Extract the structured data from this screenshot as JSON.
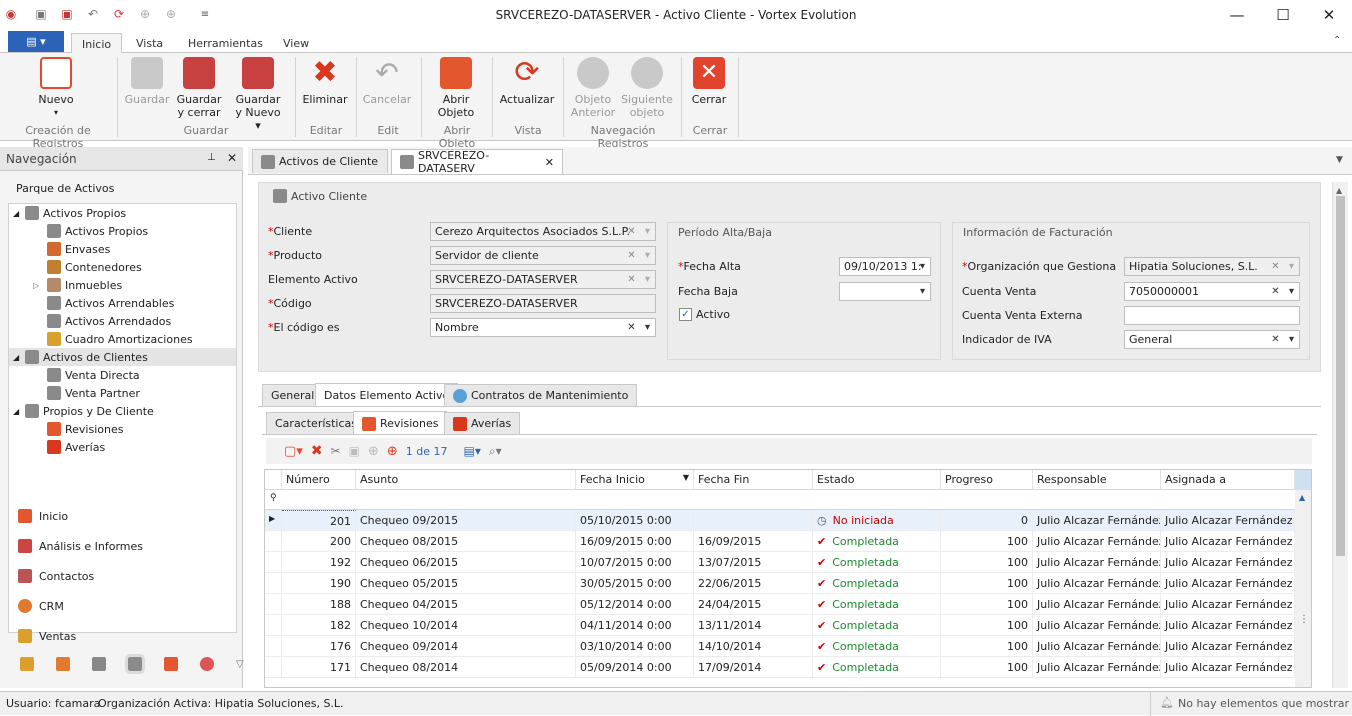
{
  "window": {
    "title": "SRVCEREZO-DATASERVER - Activo Cliente - Vortex Evolution"
  },
  "ribbon_tabs": [
    "Inicio",
    "Vista",
    "Herramientas",
    "View"
  ],
  "ribbon": {
    "buttons": {
      "nuevo": "Nuevo",
      "guardar": "Guardar",
      "guardar_cerrar_1": "Guardar",
      "guardar_cerrar_2": "y cerrar",
      "guardar_nuevo_1": "Guardar",
      "guardar_nuevo_2": "y Nuevo",
      "eliminar": "Eliminar",
      "cancelar": "Cancelar",
      "abrir_1": "Abrir",
      "abrir_2": "Objeto",
      "actualizar": "Actualizar",
      "obj_ant_1": "Objeto",
      "obj_ant_2": "Anterior",
      "sig_1": "Siguiente",
      "sig_2": "objeto",
      "cerrar": "Cerrar"
    },
    "groups": {
      "creacion": "Creación de Registros",
      "guardar": "Guardar",
      "editar": "Editar",
      "edit": "Edit",
      "abrir": "Abrir Objeto",
      "vista": "Vista",
      "navegacion": "Navegación Registros",
      "cerrar": "Cerrar"
    }
  },
  "nav": {
    "title": "Navegación",
    "section": "Parque de Activos",
    "tree": [
      "Activos Propios",
      "Activos Propios",
      "Envases",
      "Contenedores",
      "Inmuebles",
      "Activos Arrendables",
      "Activos Arrendados",
      "Cuadro Amortizaciones",
      "Activos de Clientes",
      "Venta Directa",
      "Venta Partner",
      "Propios y De Cliente",
      "Revisiones",
      "Averías"
    ],
    "links": [
      "Inicio",
      "Análisis e Informes",
      "Contactos",
      "CRM",
      "Ventas"
    ]
  },
  "doc_tabs": [
    "Activos de Cliente",
    "SRVCEREZO-DATASERV"
  ],
  "form": {
    "header": "Activo Cliente",
    "labels": {
      "cliente": "Cliente",
      "producto": "Producto",
      "elemento": "Elemento Activo",
      "codigo": "Código",
      "codigo_es": "El código es"
    },
    "req": "*",
    "values": {
      "cliente": "Cerezo Arquitectos Asociados S.L.P.",
      "producto": "Servidor de cliente",
      "elemento": "SRVCEREZO-DATASERVER",
      "codigo": "SRVCEREZO-DATASERVER",
      "codigo_es": "Nombre"
    },
    "periodo": {
      "title": "Período Alta/Baja",
      "fecha_alta_label": "Fecha Alta",
      "fecha_alta": "09/10/2013 1:",
      "fecha_baja_label": "Fecha Baja",
      "activo_label": "Activo"
    },
    "facturacion": {
      "title": "Información de Facturación",
      "org_label": "Organización que Gestiona",
      "org": "Hipatia Soluciones, S.L.",
      "cv_label": "Cuenta Venta",
      "cv": "7050000001",
      "cve_label": "Cuenta Venta Externa",
      "iva_label": "Indicador de IVA",
      "iva": "General"
    }
  },
  "sub_tabs": [
    "General",
    "Datos Elemento Activo",
    "Contratos de Mantenimiento"
  ],
  "inner_tabs": [
    "Características",
    "Revisiones",
    "Averías"
  ],
  "pager": "1 de 17",
  "grid": {
    "columns": [
      "Número",
      "Asunto",
      "Fecha Inicio",
      "Fecha Fin",
      "Estado",
      "Progreso",
      "Responsable",
      "Asignada a"
    ],
    "rows": [
      [
        "201",
        "Chequeo 09/2015",
        "05/10/2015 0:00",
        "",
        "No iniciada",
        "0",
        "Julio Alcazar Fernández",
        "Julio Alcazar Fernández"
      ],
      [
        "200",
        "Chequeo 08/2015",
        "16/09/2015 0:00",
        "16/09/2015",
        "Completada",
        "100",
        "Julio Alcazar Fernández",
        "Julio Alcazar Fernández"
      ],
      [
        "192",
        "Chequeo 06/2015",
        "10/07/2015 0:00",
        "13/07/2015",
        "Completada",
        "100",
        "Julio Alcazar Fernández",
        "Julio Alcazar Fernández"
      ],
      [
        "190",
        "Chequeo 05/2015",
        "30/05/2015 0:00",
        "22/06/2015",
        "Completada",
        "100",
        "Julio Alcazar Fernández",
        "Julio Alcazar Fernández"
      ],
      [
        "188",
        "Chequeo 04/2015",
        "05/12/2014 0:00",
        "24/04/2015",
        "Completada",
        "100",
        "Julio Alcazar Fernández",
        "Julio Alcazar Fernández"
      ],
      [
        "182",
        "Chequeo 10/2014",
        "04/11/2014 0:00",
        "13/11/2014",
        "Completada",
        "100",
        "Julio Alcazar Fernández",
        "Julio Alcazar Fernández"
      ],
      [
        "176",
        "Chequeo 09/2014",
        "03/10/2014 0:00",
        "14/10/2014",
        "Completada",
        "100",
        "Julio Alcazar Fernández",
        "Julio Alcazar Fernández"
      ],
      [
        "171",
        "Chequeo 08/2014",
        "05/09/2014 0:00",
        "17/09/2014",
        "Completada",
        "100",
        "Julio Alcazar Fernández",
        "Julio Alcazar Fernández"
      ]
    ]
  },
  "status": {
    "user": "Usuario: fcamara",
    "org": "Organización Activa: Hipatia Soluciones, S.L.",
    "right": "No hay elementos que mostrar"
  }
}
